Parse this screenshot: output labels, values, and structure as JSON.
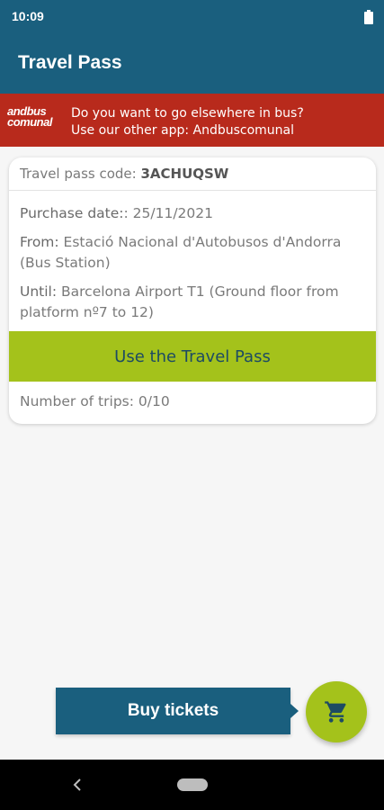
{
  "status_bar": {
    "time": "10:09",
    "battery_icon": "battery-full-icon"
  },
  "app_bar": {
    "title": "Travel Pass",
    "color": "#1a5f7e"
  },
  "promo": {
    "logo_line1": "andbus",
    "logo_line2": "comunal",
    "line1": "Do you want to go elsewhere in bus?",
    "line2": "Use our other app: Andbuscomunal",
    "color": "#b82a1c"
  },
  "pass": {
    "code_label": "Travel pass code: ",
    "code_value": "3ACHUQSW",
    "purchase_label": "Purchase date:",
    "purchase_value": ": 25/11/2021",
    "from_label": "From:",
    "from_value": " Estació Nacional d'Autobusos d'Andorra (Bus Station)",
    "until_label": "Until:",
    "until_value": " Barcelona Airport T1 (Ground floor from platform nº7 to 12)",
    "use_button_label": "Use the Travel Pass",
    "trips_label": "Number of trips: ",
    "trips_value": "0/10",
    "accent_color": "#a4c21b"
  },
  "actions": {
    "buy_label": "Buy tickets",
    "cart_icon": "shopping-cart-icon"
  },
  "nav": {
    "back_icon": "back-chevron-icon",
    "home_icon": "home-pill-icon"
  }
}
